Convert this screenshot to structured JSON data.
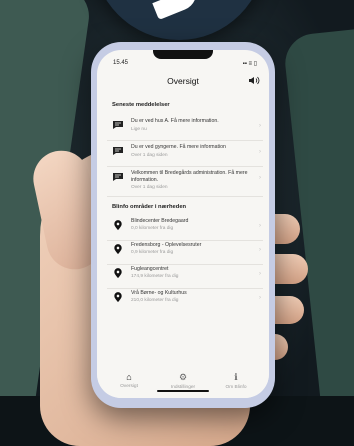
{
  "status": {
    "time": "15.45",
    "icons": "▪▪ ≡ ▯"
  },
  "header": {
    "title": "Oversigt",
    "speaker_icon": "speaker-icon"
  },
  "messages": {
    "heading": "Seneste meddelelser",
    "items": [
      {
        "title": "Du er ved hus A. Få mere information.",
        "time": "Lige nu"
      },
      {
        "title": "Du er ved gyngerne. Få mere information",
        "time": "Over 1 dag siden"
      },
      {
        "title": "Velkommen til Bredegårds administration. Få mere information.",
        "time": "Over 1 dag siden"
      }
    ]
  },
  "areas": {
    "heading": "Blinfo områder i nærheden",
    "items": [
      {
        "name": "Blindecenter Bredegaard",
        "distance": "0,0 kilometer fra dig"
      },
      {
        "name": "Fredensborg - Oplevelsesruter",
        "distance": "0,9 kilometer fra dig"
      },
      {
        "name": "Fugleangcentret",
        "distance": "174,9 kilometer fra dig"
      },
      {
        "name": "Vrå Børne- og Kulturhus",
        "distance": "210,0 kilometer fra dig"
      }
    ]
  },
  "tabs": [
    {
      "label": "Oversigt",
      "icon": "home-icon",
      "active": true
    },
    {
      "label": "Indstillinger",
      "icon": "gear-icon",
      "active": false
    },
    {
      "label": "Om Blinfo",
      "icon": "info-icon",
      "active": false
    }
  ]
}
